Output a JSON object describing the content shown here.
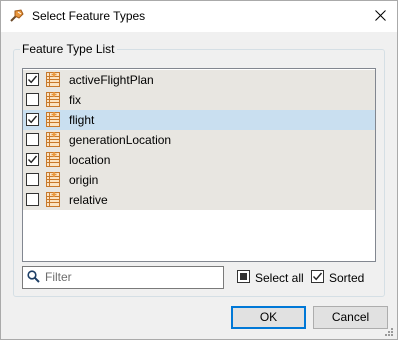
{
  "window": {
    "title": "Select Feature Types",
    "title_icon": "fme-workbench-icon",
    "close_icon": "close-icon"
  },
  "group": {
    "label": "Feature Type List"
  },
  "feature_types": [
    {
      "name": "activeFlightPlan",
      "checked": true,
      "selected": false
    },
    {
      "name": "fix",
      "checked": false,
      "selected": false
    },
    {
      "name": "flight",
      "checked": true,
      "selected": true
    },
    {
      "name": "generationLocation",
      "checked": false,
      "selected": false
    },
    {
      "name": "location",
      "checked": true,
      "selected": false
    },
    {
      "name": "origin",
      "checked": false,
      "selected": false
    },
    {
      "name": "relative",
      "checked": false,
      "selected": false
    }
  ],
  "filter": {
    "placeholder": "Filter",
    "value": ""
  },
  "options": {
    "select_all": {
      "label": "Select all",
      "state": "partial"
    },
    "sorted": {
      "label": "Sorted",
      "checked": true
    }
  },
  "buttons": {
    "ok": "OK",
    "cancel": "Cancel"
  },
  "colors": {
    "row_bg": "#e8e6e1",
    "selected_bg": "#c9dff0",
    "accent": "#0078d7",
    "icon_orange": "#e8963c"
  }
}
